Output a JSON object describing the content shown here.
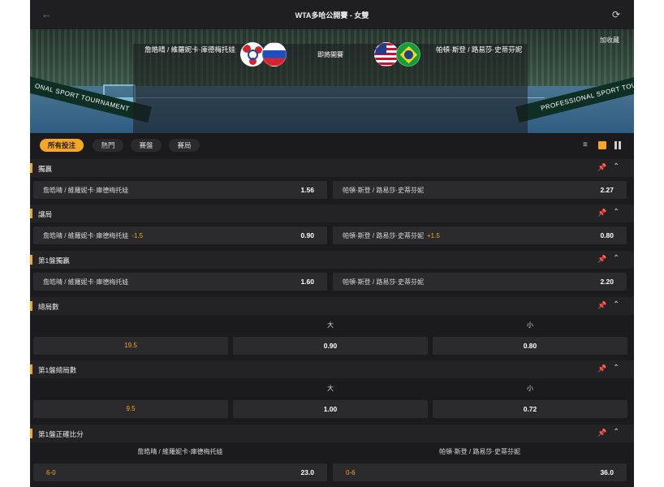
{
  "header": {
    "title": "WTA多哈公開賽 - 女雙",
    "back_icon": "arrow-left-icon",
    "refresh_icon": "refresh-icon"
  },
  "banner": {
    "favorite_label": "加收藏",
    "home_team": "詹皓晴 / 維羅妮卡·庫德梅托娃",
    "away_team": "帕頓·斯登 / 路易莎·史蒂芬妮",
    "status": "即將開賽",
    "left_sign": "ONAL SPORT TOURNAMENT",
    "right_sign": "PROFESSIONAL SPORT TOUR"
  },
  "tabs": [
    {
      "label": "所有投注",
      "active": true
    },
    {
      "label": "熱門",
      "active": false
    },
    {
      "label": "賽盤",
      "active": false
    },
    {
      "label": "賽局",
      "active": false
    }
  ],
  "markets": {
    "match_winner": {
      "title": "獨贏",
      "home": {
        "label": "詹皓晴 / 維羅妮卡·庫德梅托娃",
        "odds": "1.56"
      },
      "away": {
        "label": "帕頓·斯登 / 路易莎·史蒂芬妮",
        "odds": "2.27"
      }
    },
    "game_handicap": {
      "title": "讓局",
      "home": {
        "label": "詹皓晴 / 維羅妮卡·庫德梅托娃",
        "handicap": "-1.5",
        "odds": "0.90"
      },
      "away": {
        "label": "帕頓·斯登 / 路易莎·史蒂芬妮",
        "handicap": "+1.5",
        "odds": "0.80"
      }
    },
    "set1_winner": {
      "title": "第1盤獨贏",
      "home": {
        "label": "詹皓晴 / 維羅妮卡·庫德梅托娃",
        "odds": "1.60"
      },
      "away": {
        "label": "帕頓·斯登 / 路易莎·史蒂芬妮",
        "odds": "2.20"
      }
    },
    "total_games": {
      "title": "總局數",
      "over_label": "大",
      "under_label": "小",
      "line": "19.5",
      "over_odds": "0.90",
      "under_odds": "0.80"
    },
    "set1_total_games": {
      "title": "第1盤總局數",
      "over_label": "大",
      "under_label": "小",
      "line": "9.5",
      "over_odds": "1.00",
      "under_odds": "0.72"
    },
    "set1_correct_score": {
      "title": "第1盤正確比分",
      "home_head": "詹皓晴 / 維羅妮卡·庫德梅托娃",
      "away_head": "帕頓·斯登 / 路易莎·史蒂芬妮",
      "home": {
        "score": "6-0",
        "odds": "23.0"
      },
      "away": {
        "score": "0-6",
        "odds": "36.0"
      }
    }
  },
  "icons": {
    "pin": "pin-icon",
    "collapse": "chevron-up-icon"
  },
  "colors": {
    "accent": "#f5a623",
    "background": "#1b1b1d",
    "cell": "#2b2b2d"
  }
}
